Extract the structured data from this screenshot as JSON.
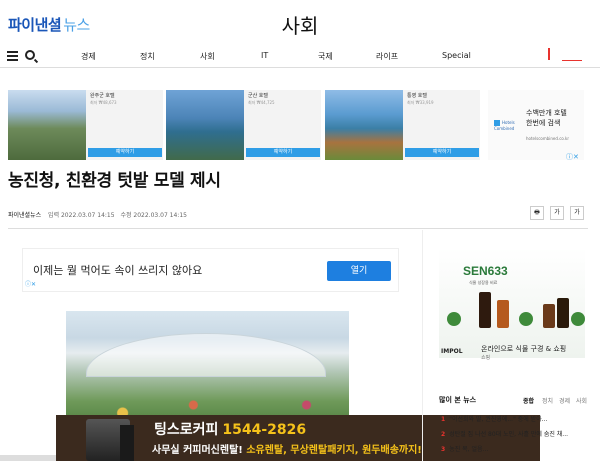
{
  "header": {
    "logo_main": "파이낸셜",
    "logo_sub": "뉴스",
    "section_title": "사회"
  },
  "nav": {
    "items": [
      "경제",
      "정치",
      "사회",
      "IT",
      "국제",
      "라이프",
      "Special"
    ]
  },
  "hotel_ad": {
    "cards": [
      {
        "name": "완주군 호텔",
        "price": "최저 ₩48,673",
        "button": "예약하기"
      },
      {
        "name": "군산 호텔",
        "price": "최저 ₩44,725",
        "button": "예약하기"
      },
      {
        "name": "통영 호텔",
        "price": "최저 ₩33,919",
        "button": "예약하기"
      }
    ],
    "hc_brand": "Hotels Combined",
    "hc_line1": "수백만개 호텔",
    "hc_line2": "한번에 검색",
    "hc_url": "hotelscombined.co.kr"
  },
  "article": {
    "headline": "농진청, 친환경 텃밭 모델 제시",
    "source": "파이낸셜뉴스",
    "published": "입력 2022.03.07 14:15",
    "modified": "수정 2022.03.07 14:15",
    "font_small": "가",
    "font_large": "가"
  },
  "inline_ad": {
    "text": "이제는 뭘 먹어도 속이 쓰리지 않아요",
    "button": "열기"
  },
  "banner": {
    "line1": "팅스로커피",
    "phone": "1544-2826",
    "line2a": "사무실 커피머신렌탈!",
    "line2b": "소유렌탈, 무상렌탈패키지, 원두배송까지!"
  },
  "sidebar_ad": {
    "brand": "SEN633",
    "sub": "식물 성장용 비료",
    "company": "IMPOL",
    "text": "온라인으로 식물 구경 & 쇼핑",
    "subtext": "쇼핑"
  },
  "popular": {
    "title": "많이 본 뉴스",
    "tabs": [
      "종합",
      "정치",
      "경제",
      "사회"
    ],
    "items": [
      {
        "rank": "1",
        "text": "\"이선희와 딸, 권진영에...\" 중에 받아..."
      },
      {
        "rank": "2",
        "text": "성탄절 집 나선 80대 노인, 사흘 만에 숨진 채..."
      },
      {
        "rank": "3",
        "text": "농진 복, 얼음..."
      }
    ]
  },
  "colors": {
    "brand_blue": "#1a56b8",
    "accent_red": "#e8332e",
    "button_blue": "#1e7fe0"
  }
}
